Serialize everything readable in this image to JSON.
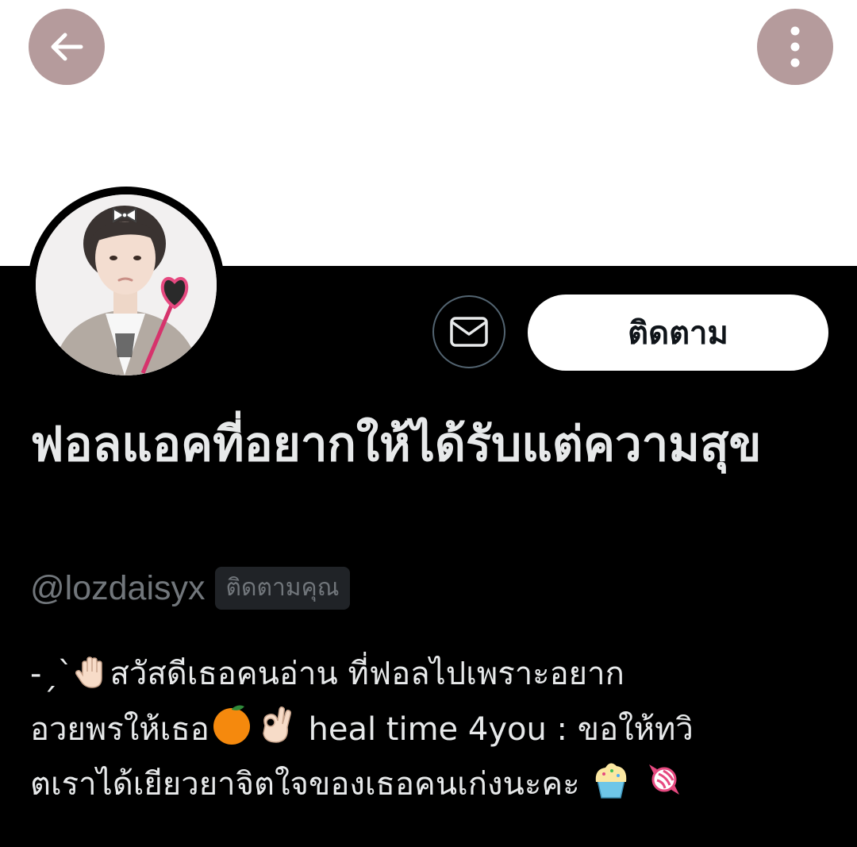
{
  "header": {
    "back_icon": "arrow-left-icon",
    "more_icon": "vertical-ellipsis-icon",
    "button_color": "#b59b9c"
  },
  "profile": {
    "avatar_description_icon": "profile-photo",
    "message_icon": "envelope-icon",
    "follow_label": "ติดตาม",
    "display_name": "ฟอลแอคที่อยากให้ได้รับแต่ความสุข",
    "handle": "@lozdaisyx",
    "follows_you_badge": "ติดตามคุณ"
  },
  "bio": {
    "line1_prefix": "-ˏˋ",
    "line1_text": "สวัสดีเธอคนอ่าน ที่ฟอลไปเพราะอยาก",
    "line2_text_a": "อวยพรให้เธอ",
    "line2_text_b": " heal time 4you : ขอให้ทวิ",
    "line3_text": "ตเราได้เยียวยาจิตใจของเธอคนเก่งนะคะ ",
    "emoji_icons": [
      "raised-hand-icon",
      "orange-icon",
      "ok-hand-icon",
      "cupcake-icon",
      "candy-icon"
    ]
  },
  "colors": {
    "background": "#000000",
    "banner": "#ffffff",
    "primary_text": "#e7e9ea",
    "secondary_text": "#71767b",
    "badge_bg": "#202327"
  }
}
